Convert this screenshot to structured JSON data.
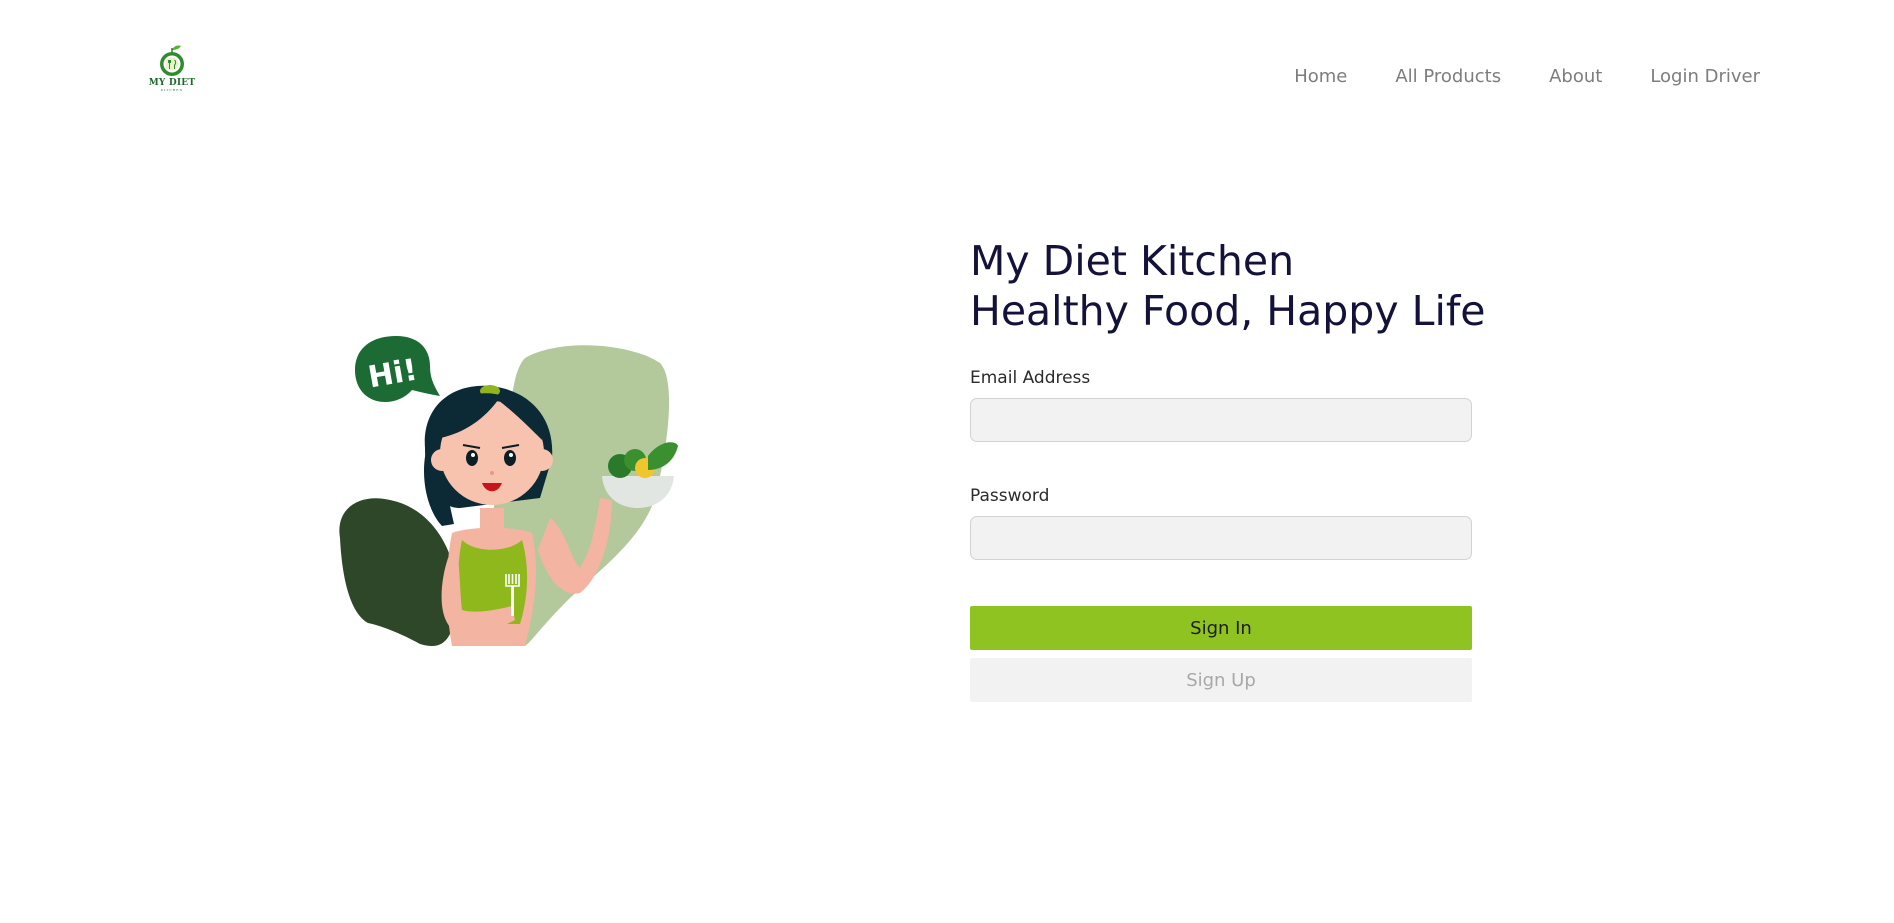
{
  "brand": {
    "logo_text": "MY DIET",
    "logo_subtext": "KITCHEN"
  },
  "nav": {
    "items": [
      {
        "label": "Home"
      },
      {
        "label": "All Products"
      },
      {
        "label": "About"
      },
      {
        "label": "Login Driver"
      }
    ]
  },
  "hero": {
    "speech_bubble": "Hi!"
  },
  "form": {
    "title_line1": "My Diet Kitchen",
    "title_line2": "Healthy Food, Happy Life",
    "email_label": "Email Address",
    "email_value": "",
    "password_label": "Password",
    "password_value": "",
    "sign_in_label": "Sign In",
    "sign_up_label": "Sign Up"
  },
  "colors": {
    "accent": "#8fc322",
    "title": "#12123a",
    "nav_text": "#7d7d7d",
    "logo_green": "#1d6b2c"
  }
}
